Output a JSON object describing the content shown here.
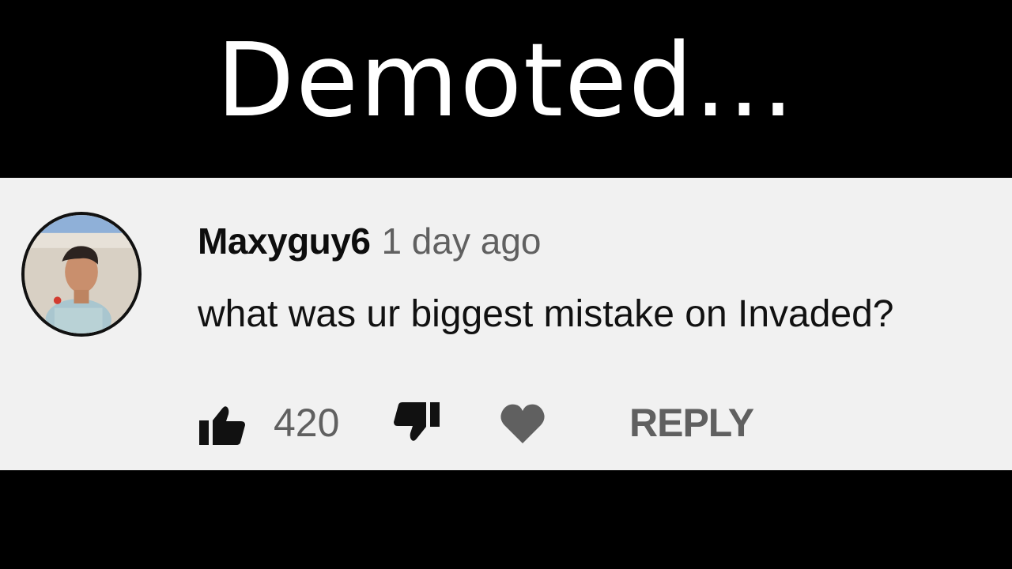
{
  "title": "Demoted...",
  "comment": {
    "username": "Maxyguy6",
    "timestamp": "1 day ago",
    "text": "what was ur biggest mistake on Invaded?",
    "like_count": "420",
    "reply_label": "REPLY"
  },
  "icons": {
    "like": "thumbs-up-icon",
    "dislike": "thumbs-down-icon",
    "heart": "heart-icon"
  },
  "colors": {
    "background": "#000000",
    "panel": "#f1f1f1",
    "title_text": "#ffffff",
    "username": "#0d0d0d",
    "secondary": "#606060"
  }
}
